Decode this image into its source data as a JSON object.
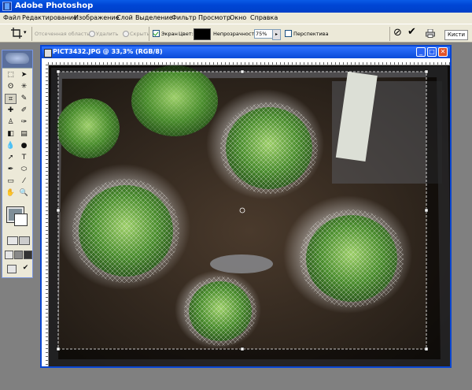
{
  "app": {
    "title": "Adobe Photoshop"
  },
  "menu": [
    "Файл",
    "Редактирование",
    "Изображение",
    "Слой",
    "Выделение",
    "Фильтр",
    "Просмотр",
    "Окно",
    "Справка"
  ],
  "options": {
    "shielded_area_label": "Отсеченная область:",
    "delete_label": "Удалить",
    "hide_label": "Скрыть",
    "screen_label": "Экран",
    "color_label": "Цвет:",
    "opacity_label": "Непрозрачность:",
    "opacity_value": "75%",
    "perspective_label": "Перспектива",
    "brushes_label": "Кисти",
    "shield_color": "#000000"
  },
  "document": {
    "title": "PICT3432.JPG @ 33,3% (RGB/8)"
  },
  "colors": {
    "foreground": "#7f8e98",
    "background": "#ffffff",
    "titlebar": "#0054e3"
  }
}
